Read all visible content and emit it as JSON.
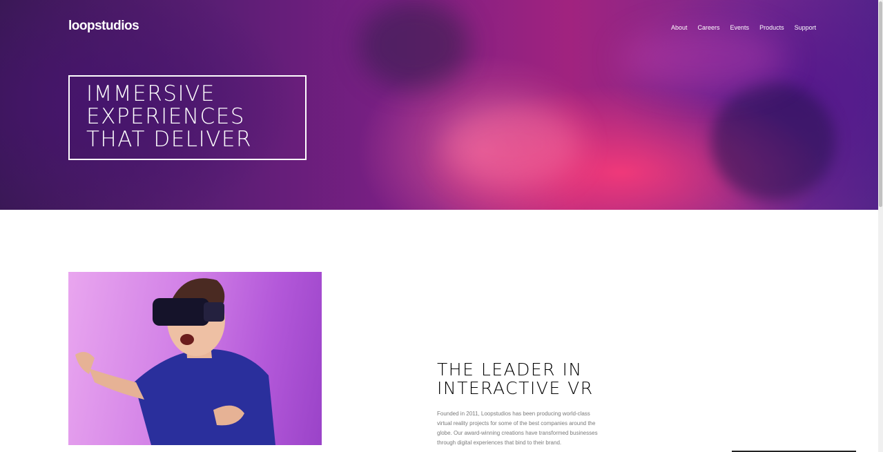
{
  "header": {
    "logo": "loopstudios",
    "nav": [
      "About",
      "Careers",
      "Events",
      "Products",
      "Support"
    ]
  },
  "hero": {
    "lines": [
      "IMMERSIVE",
      "EXPERIENCES",
      "THAT DELIVER"
    ]
  },
  "intro": {
    "title_lines": [
      "THE LEADER IN",
      "INTERACTIVE VR"
    ],
    "body": "Founded in 2011, Loopstudios has been producing world-class virtual reality projects for some of the best companies around the globe. Our award-winning creations have transformed businesses through digital experiences that bind to their brand."
  },
  "colors": {
    "hero_purple": "#7b1f84",
    "hero_pink": "#ff3c78",
    "text_gray": "#7a7a7a"
  }
}
